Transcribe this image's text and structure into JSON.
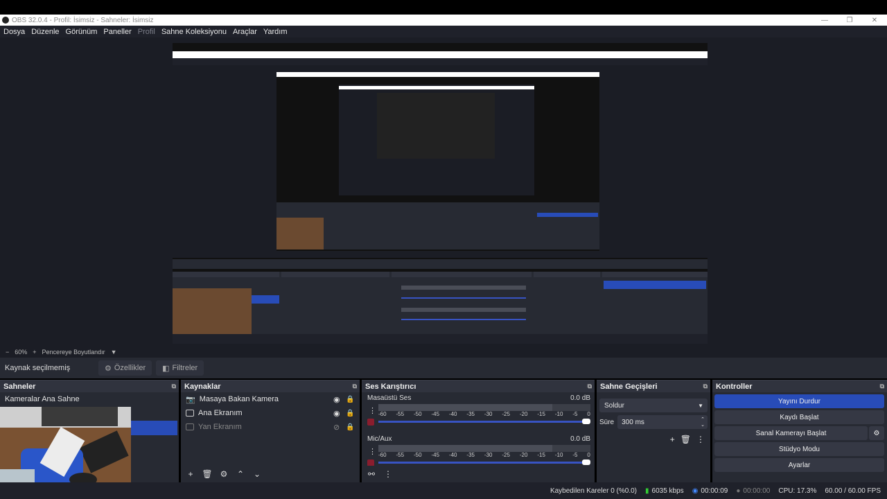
{
  "window": {
    "title": "OBS 32.0.4 - Profil: İsimsiz - Sahneler: İsimsiz",
    "controls": [
      "—",
      "❐",
      "✕"
    ]
  },
  "menu": [
    "Dosya",
    "Düzenle",
    "Görünüm",
    "Paneller",
    "Profil",
    "Sahne Koleksiyonu",
    "Araçlar",
    "Yardım"
  ],
  "zoom": {
    "minus": "−",
    "value": "60%",
    "plus": "+",
    "mode": "Pencereye Boyutlandır"
  },
  "sourcebar": {
    "label": "Kaynak seçilmemiş",
    "properties": "Özellikler",
    "filters": "Filtreler"
  },
  "scenes": {
    "title": "Sahneler",
    "items": [
      "Kameralar Ana Sahne"
    ]
  },
  "sources": {
    "title": "Kaynaklar",
    "items": [
      {
        "name": "Masaya Bakan Kamera",
        "visible": true
      },
      {
        "name": "Ana Ekranım",
        "visible": true
      },
      {
        "name": "Yan Ekranım",
        "visible": false
      }
    ]
  },
  "mixer": {
    "title": "Ses Karıştırıcı",
    "ticks": [
      "-60",
      "-55",
      "-50",
      "-45",
      "-40",
      "-35",
      "-30",
      "-25",
      "-20",
      "-15",
      "-10",
      "-5",
      "0"
    ],
    "channels": [
      {
        "name": "Masaüstü Ses",
        "level": "0.0 dB"
      },
      {
        "name": "Mic/Aux",
        "level": "0.0 dB"
      }
    ]
  },
  "transitions": {
    "title": "Sahne Geçişleri",
    "selected": "Soldur",
    "duration_label": "Süre",
    "duration": "300 ms"
  },
  "controls": {
    "title": "Kontroller",
    "stream": "Yayını Durdur",
    "record": "Kaydı Başlat",
    "virtualcam": "Sanal Kamerayı Başlat",
    "studio": "Stüdyo Modu",
    "settings": "Ayarlar"
  },
  "status": {
    "dropped": "Kaybedilen Kareler 0 (%0.0)",
    "bitrate": "6035 kbps",
    "stream_time": "00:00:09",
    "rec_time": "00:00:00",
    "cpu": "CPU: 17.3%",
    "fps": "60.00 / 60.00 FPS"
  },
  "colors": {
    "accent": "#284cb8",
    "bg": "#272a33"
  }
}
